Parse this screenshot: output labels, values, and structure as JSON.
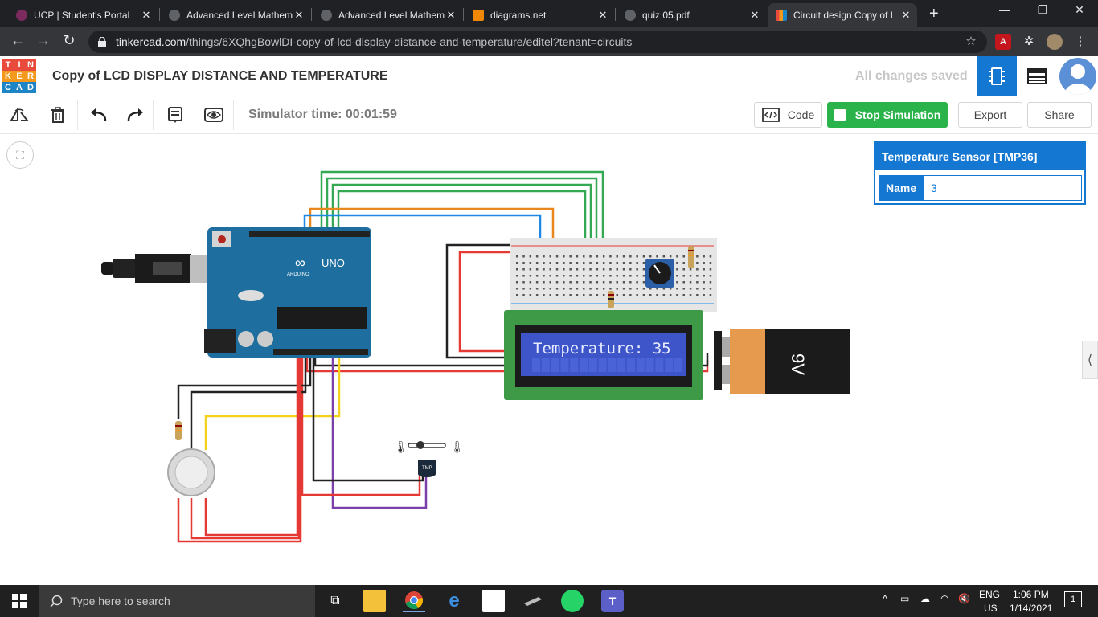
{
  "browser": {
    "tabs": [
      {
        "title": "UCP | Student's Portal",
        "active": false
      },
      {
        "title": "Advanced Level Mathem",
        "active": false
      },
      {
        "title": "Advanced Level Mathem",
        "active": false
      },
      {
        "title": "diagrams.net",
        "active": false
      },
      {
        "title": "quiz 05.pdf",
        "active": false
      },
      {
        "title": "Circuit design Copy of L",
        "active": true
      }
    ],
    "url_host": "tinkercad.com",
    "url_path": "/things/6XQhgBowlDI-copy-of-lcd-display-distance-and-temperature/editel?tenant=circuits",
    "new_tab_glyph": "+",
    "close_glyph": "✕"
  },
  "app": {
    "logo_letters": [
      "T",
      "I",
      "N",
      "K",
      "E",
      "R",
      "C",
      "A",
      "D"
    ],
    "logo_colors": [
      "#e84a3b",
      "#e84a3b",
      "#e84a3b",
      "#f39a1e",
      "#f39a1e",
      "#f39a1e",
      "#1d84c6",
      "#1d84c6",
      "#1d84c6"
    ],
    "project_title": "Copy of LCD DISPLAY DISTANCE AND TEMPERATURE",
    "save_status": "All changes saved",
    "accent_color": "#1477d2"
  },
  "toolbar": {
    "simulator_time": "Simulator time: 00:01:59",
    "code_label": "Code",
    "stop_label": "Stop Simulation",
    "export_label": "Export",
    "share_label": "Share"
  },
  "inspector": {
    "title": "Temperature Sensor [TMP36]",
    "name_label": "Name",
    "name_value": "3"
  },
  "circuit": {
    "lcd_text": "Temperature: 35",
    "arduino_model": "UNO",
    "arduino_brand": "ARDUINO",
    "battery_label": "9V",
    "sensor_label": "TMP"
  },
  "taskbar": {
    "search_placeholder": "Type here to search",
    "language_1": "ENG",
    "language_2": "US",
    "time": "1:06 PM",
    "date": "1/14/2021",
    "notifications": "1"
  }
}
